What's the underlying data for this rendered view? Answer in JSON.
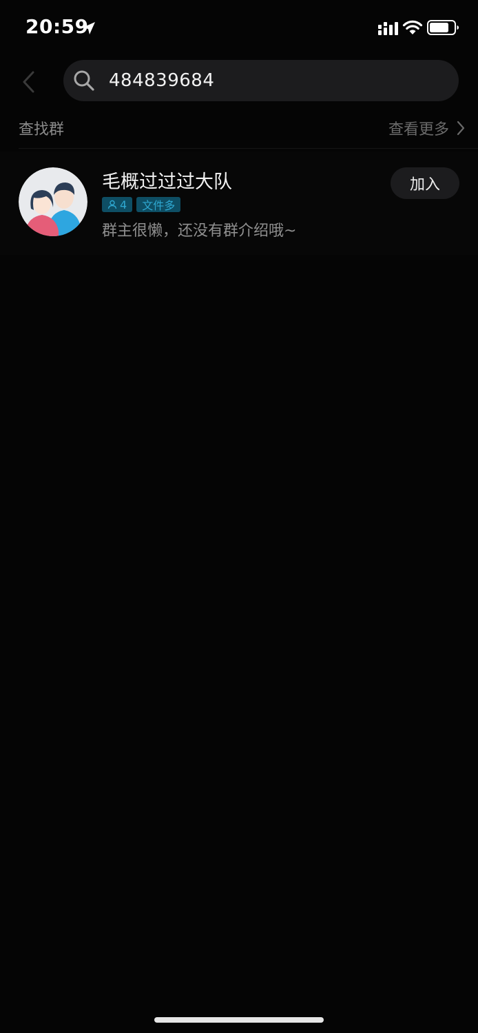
{
  "status_bar": {
    "time": "20:59",
    "icons": [
      "location-arrow-icon",
      "cellular-signal-icon",
      "wifi-icon",
      "battery-icon"
    ]
  },
  "header": {
    "back_icon": "chevron-left-icon",
    "search": {
      "icon": "search-icon",
      "value": "484839684"
    }
  },
  "section": {
    "title": "查找群",
    "see_more_label": "查看更多",
    "see_more_icon": "chevron-right-icon"
  },
  "results": [
    {
      "avatar_icon": "group-avatar-icon",
      "name": "毛概过过过大队",
      "member_count": "4",
      "badge": "文件多",
      "intro": "群主很懒，还没有群介绍哦~",
      "join_label": "加入"
    }
  ],
  "colors": {
    "background": "#050505",
    "search_bg": "#1c1c1e",
    "tag_bg": "#0e4e64",
    "tag_text": "#2fa8d1",
    "muted_text": "#8a8a8a"
  }
}
